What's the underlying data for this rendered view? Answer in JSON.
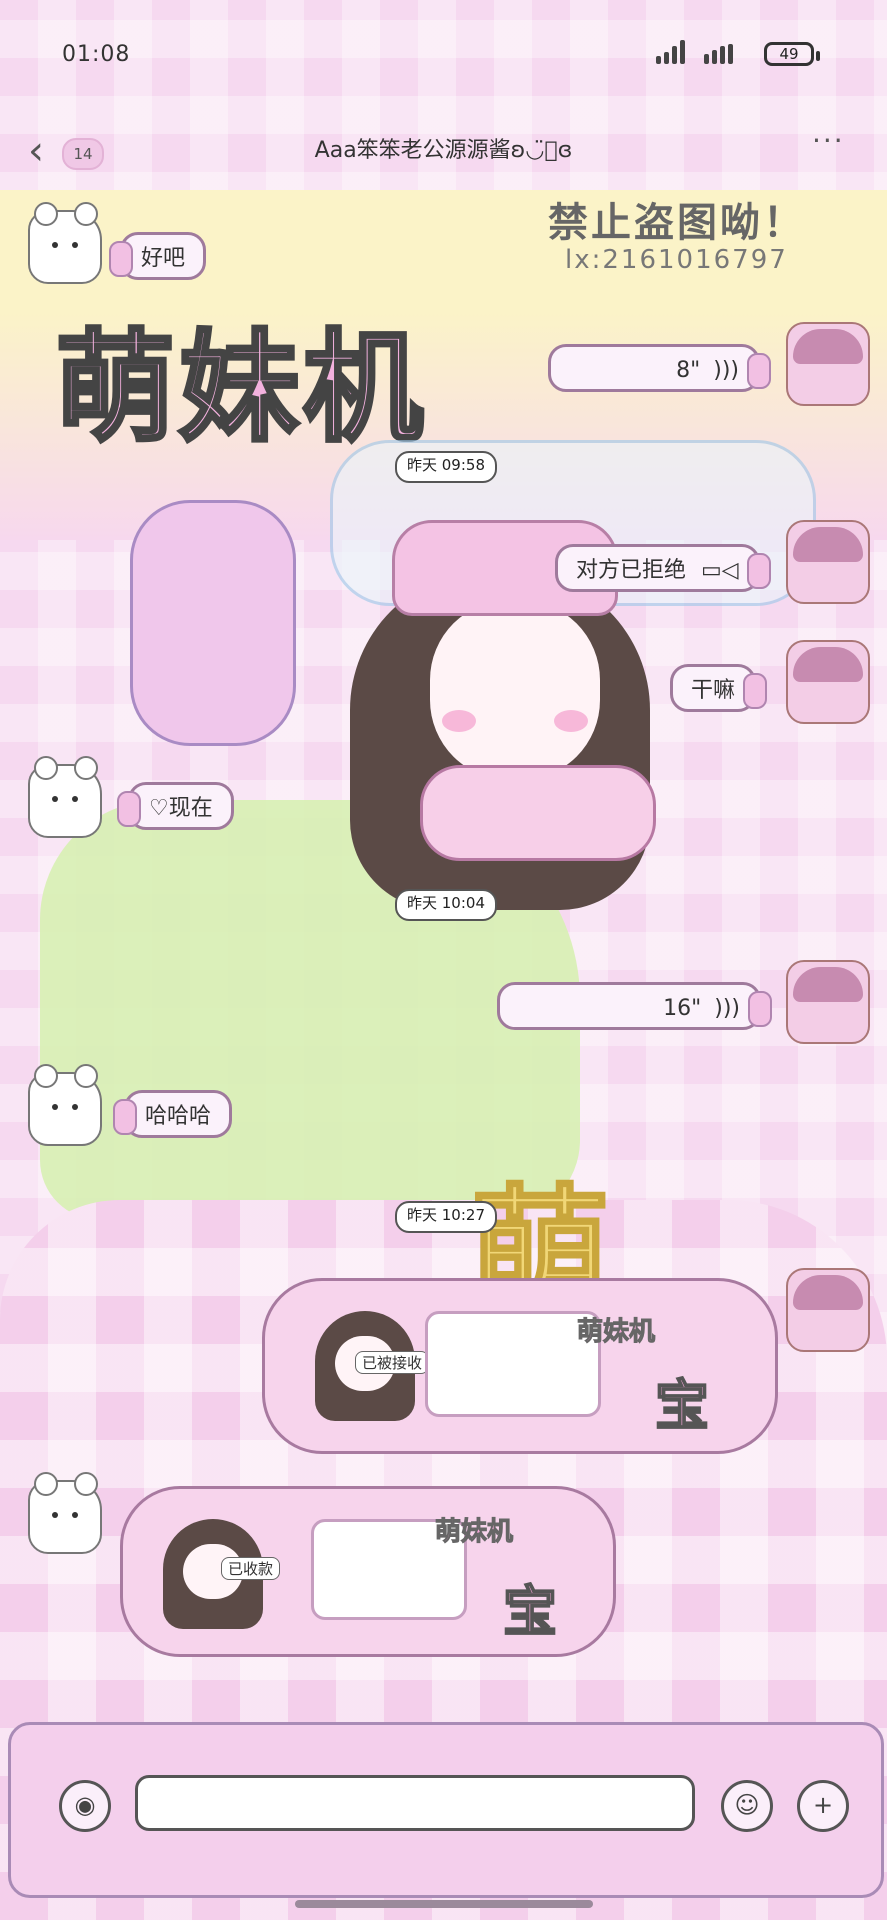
{
  "status": {
    "time": "01:08",
    "battery": "49"
  },
  "header": {
    "unread": "14",
    "title": "Aaa笨笨老公源源酱ʚ◡̈⃝ɞ",
    "more": "···"
  },
  "banner": {
    "warning": "禁止盗图呦！",
    "id": "lx:2161016797",
    "big_text": "萌妹机"
  },
  "messages": [
    {
      "side": "left",
      "text": "好吧"
    },
    {
      "side": "right",
      "text": "8\"",
      "kind": "voice"
    },
    {
      "timestamp": "昨天 09:58"
    },
    {
      "side": "right",
      "text": "对方已拒绝",
      "kind": "video-call"
    },
    {
      "side": "right",
      "text": "干嘛"
    },
    {
      "side": "left",
      "text": "♡现在"
    },
    {
      "timestamp": "昨天 10:04"
    },
    {
      "side": "right",
      "text": "16\"",
      "kind": "voice"
    },
    {
      "side": "left",
      "text": "哈哈哈"
    },
    {
      "timestamp": "昨天 10:27"
    },
    {
      "side": "right",
      "kind": "transfer",
      "label": "已被接收",
      "brand": "萌妹机",
      "tag": "宝"
    },
    {
      "side": "left",
      "kind": "transfer",
      "label": "已收款",
      "brand": "萌妹机",
      "tag": "宝"
    }
  ],
  "icons": {
    "voice_input": "voice-icon",
    "emoji": "emoji-icon",
    "plus": "plus-icon",
    "back": "back-chevron-icon",
    "speaker": "speaker-icon",
    "video": "video-camera-icon"
  }
}
